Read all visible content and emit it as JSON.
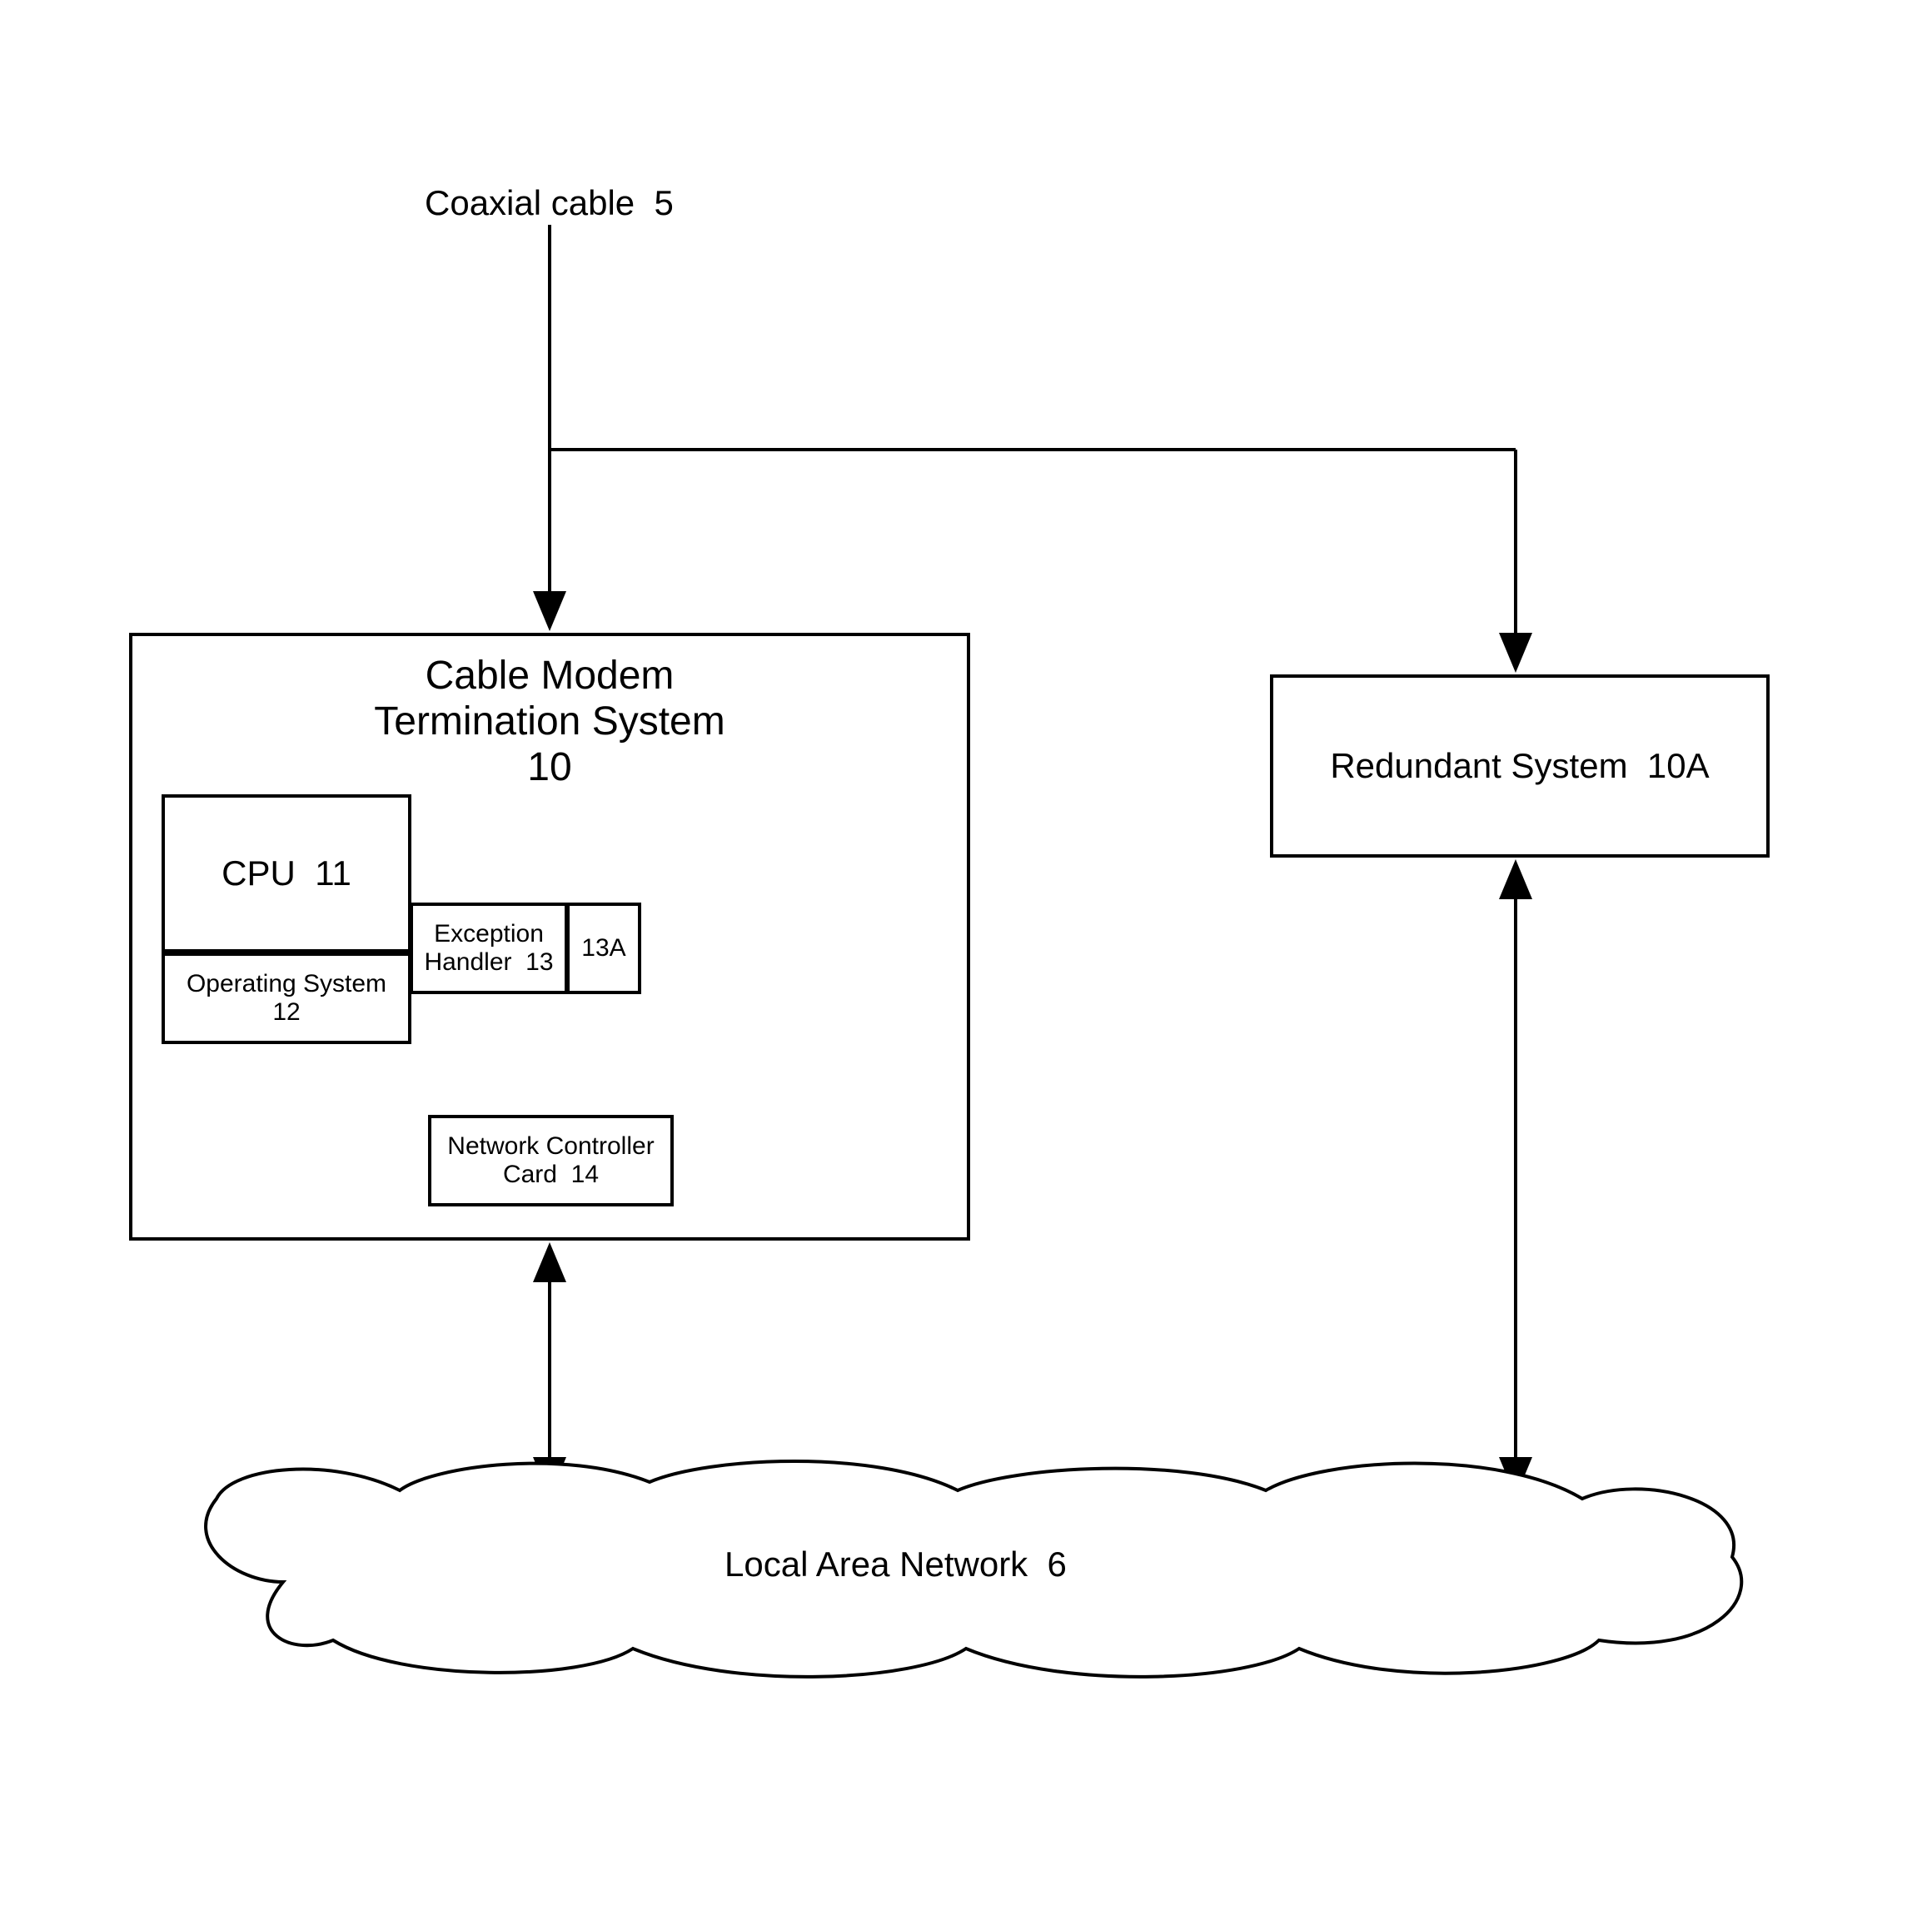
{
  "coaxial_cable": {
    "label": "Coaxial cable",
    "ref": "5"
  },
  "cmts": {
    "title_line1": "Cable Modem",
    "title_line2": "Termination System",
    "ref": "10",
    "cpu": {
      "label": "CPU",
      "ref": "11"
    },
    "os": {
      "label": "Operating System",
      "ref": "12"
    },
    "exception_handler": {
      "label_line1": "Exception",
      "label_line2": "Handler",
      "ref": "13"
    },
    "exception_sub": {
      "ref": "13A"
    },
    "network_controller": {
      "label_line1": "Network Controller",
      "label_line2": "Card",
      "ref": "14"
    }
  },
  "redundant_system": {
    "label": "Redundant System",
    "ref": "10A"
  },
  "lan": {
    "label": "Local Area Network",
    "ref": "6"
  }
}
